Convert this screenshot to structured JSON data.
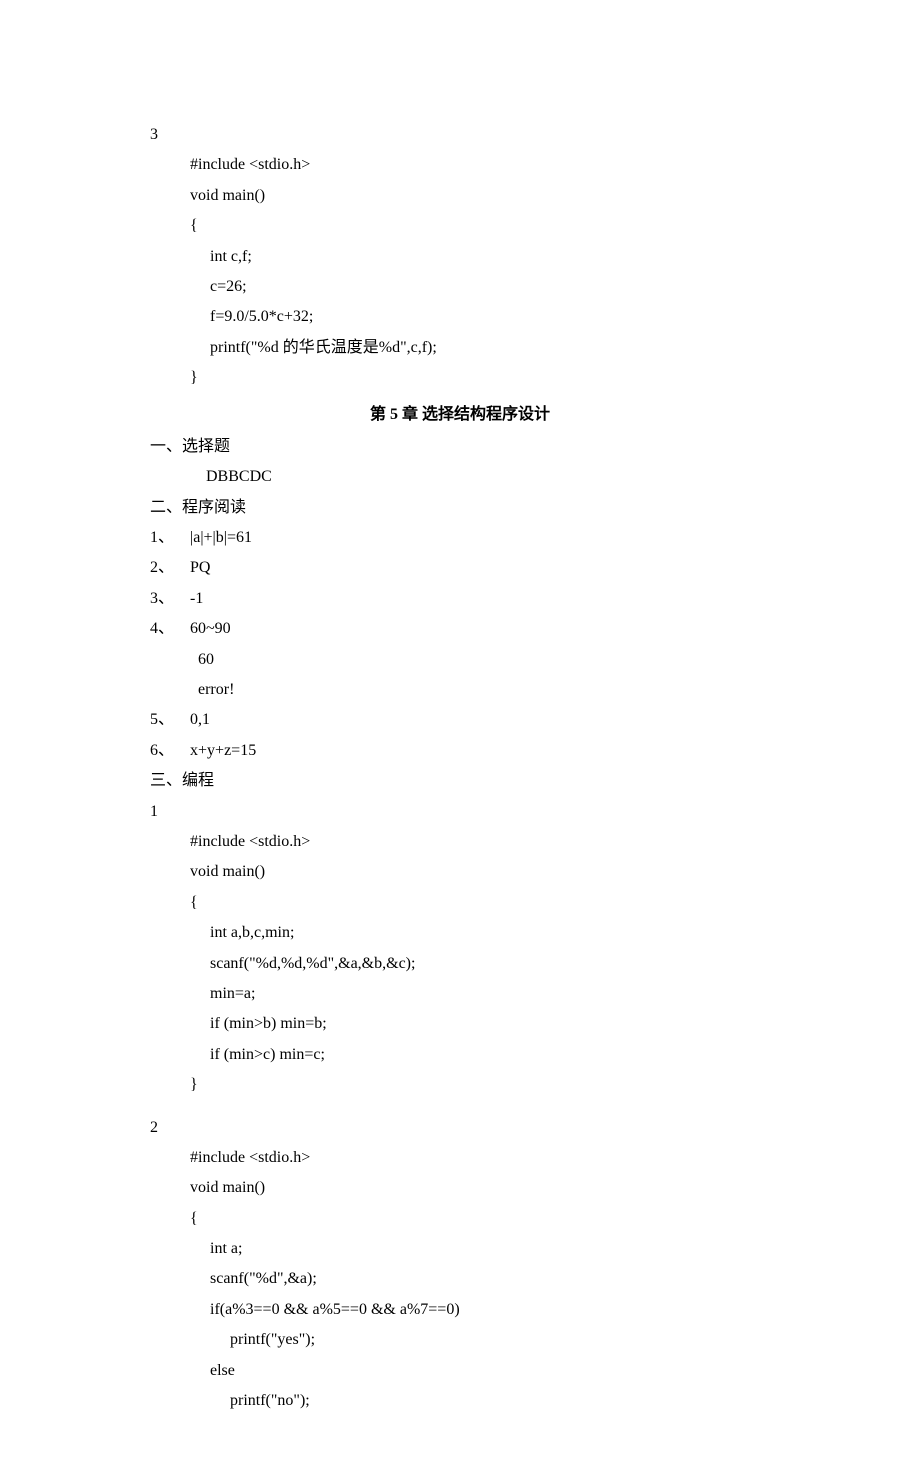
{
  "code3_label": "3",
  "code3_lines": [
    "#include <stdio.h>",
    "void main()",
    "{",
    "     int c,f;",
    "     c=26;",
    "     f=9.0/5.0*c+32;",
    "     printf(\"%d 的华氏温度是%d\",c,f);",
    "}"
  ],
  "chapter_title_a": "第",
  "chapter_title_num": " 5 ",
  "chapter_title_b": "章  选择结构程序设计",
  "section1_label": "一、选择题",
  "section1_answer": "DBBCDC",
  "section2_label": "二、程序阅读",
  "section2_items": [
    [
      "1、",
      "|a|+|b|=61"
    ],
    [
      "2、",
      "PQ"
    ],
    [
      "3、",
      "-1"
    ],
    [
      "4、",
      "60~90"
    ],
    [
      "",
      "60"
    ],
    [
      "",
      "error!"
    ],
    [
      "5、",
      "0,1"
    ],
    [
      "6、",
      "x+y+z=15"
    ]
  ],
  "section3_label": "三、编程",
  "prog1_label": "1",
  "prog1_lines": [
    "#include <stdio.h>",
    "void main()",
    "{",
    "     int a,b,c,min;",
    "     scanf(\"%d,%d,%d\",&a,&b,&c);",
    "     min=a;",
    "     if (min>b) min=b;",
    "     if (min>c) min=c;",
    "}"
  ],
  "prog2_label": "2",
  "prog2_lines": [
    "#include <stdio.h>",
    "void main()",
    "{",
    "     int a;",
    "     scanf(\"%d\",&a);",
    "     if(a%3==0 && a%5==0 && a%7==0)",
    "          printf(\"yes\");",
    "     else",
    "          printf(\"no\");"
  ]
}
